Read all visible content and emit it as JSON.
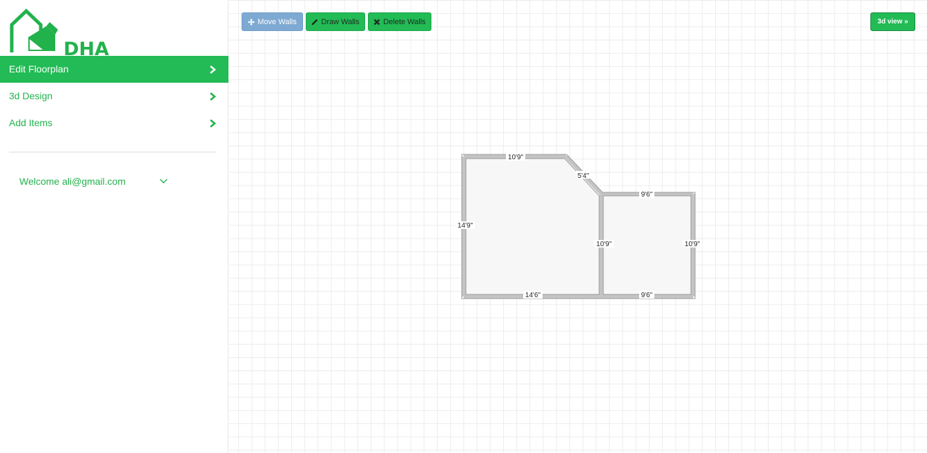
{
  "brand": {
    "logo_text": "DHA",
    "color": "#22b24c"
  },
  "sidebar": {
    "items": [
      {
        "label": "Edit Floorplan",
        "active": true
      },
      {
        "label": "3d Design",
        "active": false
      },
      {
        "label": "Add Items",
        "active": false
      }
    ],
    "welcome_text": "Welcome ali@gmail.com"
  },
  "toolbar": {
    "move_label": "Move Walls",
    "draw_label": "Draw Walls",
    "delete_label": "Delete Walls",
    "view3d_label": "3d view »"
  },
  "floorplan": {
    "dimensions": {
      "top_left_wall": "10'9\"",
      "diagonal_wall": "5'4\"",
      "left_wall": "14'9\"",
      "bottom_left_wall": "14'6\"",
      "shared_wall": "10'9\"",
      "top_right_wall": "9'6\"",
      "right_wall": "10'9\"",
      "bottom_right_wall": "9'6\""
    }
  },
  "colors": {
    "accent": "#22bb55",
    "move_button": "#7ea9d2",
    "grid": "#ececec",
    "room_fill": "#f7f7f7",
    "wall": "#c8c8c8"
  }
}
